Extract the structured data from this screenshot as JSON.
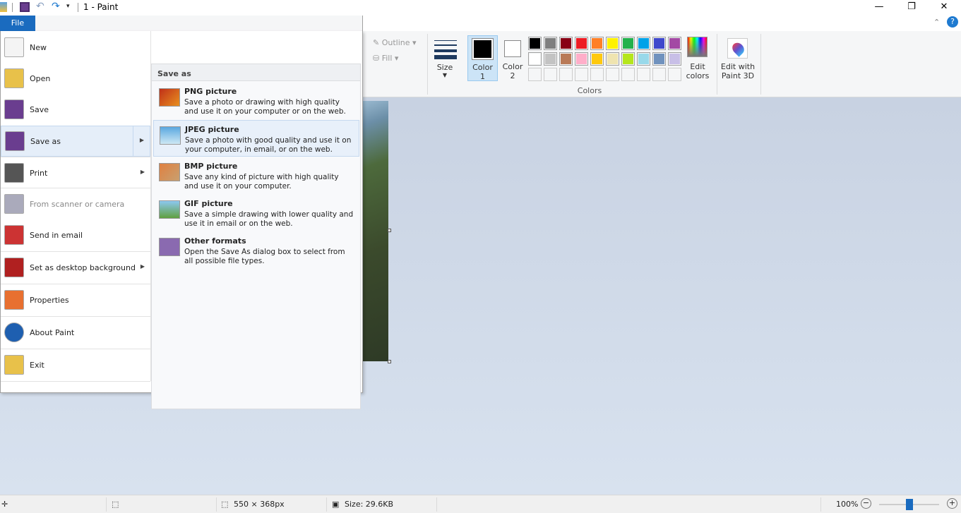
{
  "window": {
    "title": "1 - Paint",
    "minimize": "—",
    "restore": "❐",
    "close": "✕",
    "collapse": "⌃",
    "help": "?"
  },
  "file_tab": "File",
  "ribbon": {
    "outline": "Outline",
    "fill": "Fill",
    "size": "Size",
    "color1": "Color 1",
    "color1_line2": "1",
    "color1_name": "Color",
    "color2_name": "Color",
    "color2_line2": "2",
    "edit_colors": [
      "Edit",
      "colors"
    ],
    "paint3d": [
      "Edit with",
      "Paint 3D"
    ],
    "colors_group": "Colors",
    "palette_row1": [
      "#000000",
      "#7f7f7f",
      "#880015",
      "#ed1c24",
      "#ff7f27",
      "#fff200",
      "#22b14c",
      "#00a2e8",
      "#3f48cc",
      "#a349a4"
    ],
    "palette_row2": [
      "#ffffff",
      "#c3c3c3",
      "#b97a57",
      "#ffaec9",
      "#ffc90e",
      "#efe4b0",
      "#b5e61d",
      "#99d9ea",
      "#7092be",
      "#c8bfe7"
    ]
  },
  "menu": {
    "items": [
      {
        "label": "New",
        "icon": "new-page-icon"
      },
      {
        "label": "Open",
        "icon": "folder-icon"
      },
      {
        "label": "Save",
        "icon": "floppy-icon"
      },
      {
        "label": "Save as",
        "icon": "save-as-icon"
      },
      {
        "label": "Print",
        "icon": "printer-icon"
      },
      {
        "label": "From scanner or camera",
        "icon": "scanner-icon"
      },
      {
        "label": "Send in email",
        "icon": "email-icon"
      },
      {
        "label": "Set as desktop background",
        "icon": "desktop-icon"
      },
      {
        "label": "Properties",
        "icon": "checkmark-icon"
      },
      {
        "label": "About Paint",
        "icon": "info-icon"
      },
      {
        "label": "Exit",
        "icon": "exit-icon"
      }
    ]
  },
  "saveas": {
    "header": "Save as",
    "items": [
      {
        "title": "PNG picture",
        "desc": "Save a photo or drawing with high quality and use it on your computer or on the web."
      },
      {
        "title": "JPEG picture",
        "desc": "Save a photo with good quality and use it on your computer, in email, or on the web."
      },
      {
        "title": "BMP picture",
        "desc": "Save any kind of picture with high quality and use it on your computer."
      },
      {
        "title": "GIF picture",
        "desc": "Save a simple drawing with lower quality and use it in email or on the web."
      },
      {
        "title": "Other formats",
        "desc": "Open the Save As dialog box to select from all possible file types."
      }
    ]
  },
  "status": {
    "dimensions": "550 × 368px",
    "size": "Size: 29.6KB",
    "zoom": "100%",
    "zoom_level_percent": 100
  }
}
